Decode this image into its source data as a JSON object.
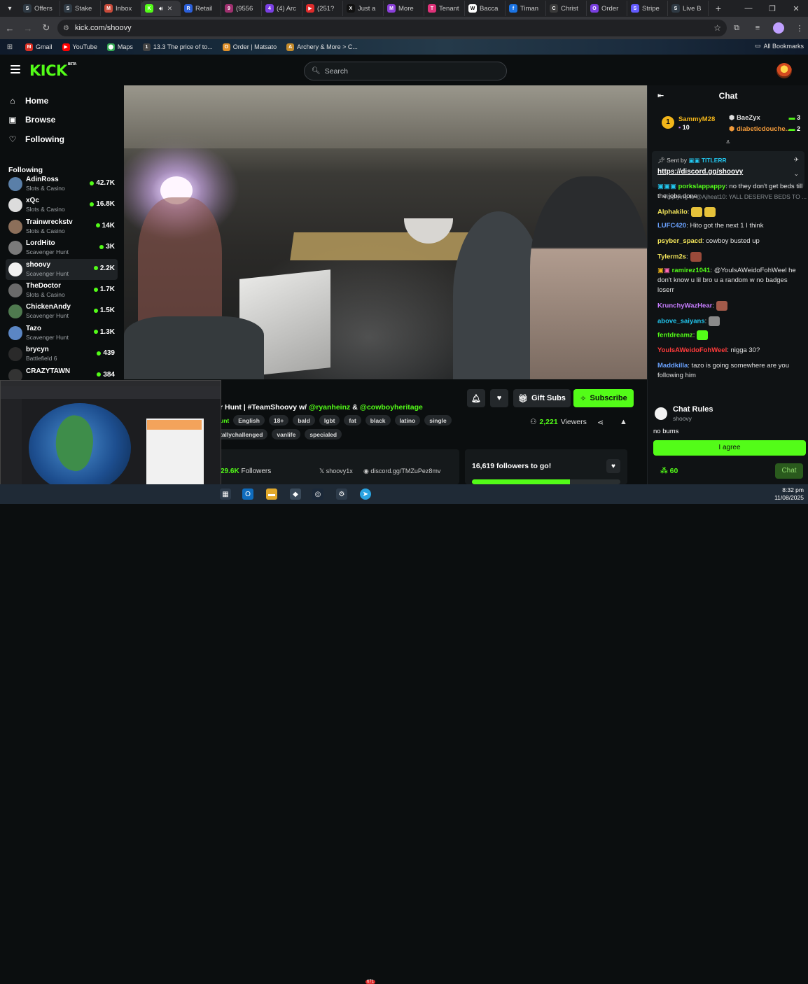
{
  "browser": {
    "tabs": [
      {
        "label": "Offers",
        "color": "#2f3a44",
        "glyph": "S"
      },
      {
        "label": "Stake",
        "color": "#2f3a44",
        "glyph": "S"
      },
      {
        "label": "Inbox",
        "color": "#c94b3b",
        "glyph": "M"
      },
      {
        "label": "",
        "color": "#53fc18",
        "glyph": "K",
        "active": true
      },
      {
        "label": "Retail",
        "color": "#2b5fd9",
        "glyph": "R"
      },
      {
        "label": "(9556",
        "color": "#a0306f",
        "glyph": "9"
      },
      {
        "label": "(4) Arc",
        "color": "#7b3fe4",
        "glyph": "4"
      },
      {
        "label": "(251?",
        "color": "#e02b2b",
        "glyph": "▶"
      },
      {
        "label": "Just a",
        "color": "#111111",
        "glyph": "X"
      },
      {
        "label": "More",
        "color": "#8b3fd9",
        "glyph": "M"
      },
      {
        "label": "Tenant",
        "color": "#e0327a",
        "glyph": "T"
      },
      {
        "label": "Bacca",
        "color": "#ffffff",
        "glyph": "W"
      },
      {
        "label": "Timan",
        "color": "#1b74e4",
        "glyph": "f"
      },
      {
        "label": "Christ",
        "color": "#3a3a3a",
        "glyph": "C"
      },
      {
        "label": "Order",
        "color": "#7a3fe0",
        "glyph": "O"
      },
      {
        "label": "Stripe",
        "color": "#635bff",
        "glyph": "S"
      },
      {
        "label": "Live B",
        "color": "#2f3a44",
        "glyph": "S"
      }
    ],
    "url": "kick.com/shoovy",
    "bookmarks": [
      {
        "label": "Gmail",
        "color": "#d93025",
        "glyph": "M"
      },
      {
        "label": "YouTube",
        "color": "#ff0000",
        "glyph": "▶"
      },
      {
        "label": "Maps",
        "color": "#34a853",
        "glyph": "⬤"
      },
      {
        "label": "13.3 The price of to...",
        "color": "#444444",
        "glyph": "1"
      },
      {
        "label": "Order | Matsato",
        "color": "#e0912b",
        "glyph": "O"
      },
      {
        "label": "Archery & More > C...",
        "color": "#c28a2b",
        "glyph": "A"
      }
    ],
    "all_bookmarks": "All Bookmarks"
  },
  "header": {
    "logo": "KICK",
    "logo_badge": "BETA",
    "search_placeholder": "Search"
  },
  "sidebar": {
    "nav": [
      {
        "label": "Home",
        "icon": "home-icon"
      },
      {
        "label": "Browse",
        "icon": "browse-icon"
      },
      {
        "label": "Following",
        "icon": "heart-icon"
      }
    ],
    "following_label": "Following",
    "channels": [
      {
        "name": "AdinRoss",
        "category": "Slots & Casino",
        "viewers": "42.7K",
        "color": "#5a7fa8"
      },
      {
        "name": "xQc",
        "category": "Slots & Casino",
        "viewers": "16.8K",
        "color": "#dcdcdc"
      },
      {
        "name": "Trainwreckstv",
        "category": "Slots & Casino",
        "viewers": "14K",
        "color": "#8c6f5a"
      },
      {
        "name": "LordHito",
        "category": "Scavenger Hunt",
        "viewers": "3K",
        "color": "#7a7a7a"
      },
      {
        "name": "shoovy",
        "category": "Scavenger Hunt",
        "viewers": "2.2K",
        "color": "#f2f2f2",
        "active": true
      },
      {
        "name": "TheDoctor",
        "category": "Slots & Casino",
        "viewers": "1.7K",
        "color": "#6a6a6a"
      },
      {
        "name": "ChickenAndy",
        "category": "Scavenger Hunt",
        "viewers": "1.5K",
        "color": "#4f7a4f"
      },
      {
        "name": "Tazo",
        "category": "Scavenger Hunt",
        "viewers": "1.3K",
        "color": "#5b86c4"
      },
      {
        "name": "brycyn",
        "category": "Battlefield 6",
        "viewers": "439",
        "color": "#2a2a2a"
      },
      {
        "name": "CRAZYTAWN",
        "category": "",
        "viewers": "384",
        "color": "#333333"
      }
    ]
  },
  "stream": {
    "title_prefix": "r Hunt | #TeamShoovy w/ ",
    "mention1": "@ryanheinz",
    "amp": " & ",
    "mention2": "@cowboyheritage",
    "category_partial": "unt",
    "tags": [
      "English",
      "18+",
      "bald",
      "lgbt",
      "fat",
      "black",
      "latino",
      "single"
    ],
    "tags2": [
      "tallychallenged",
      "vanlife",
      "speciaIed"
    ],
    "gift_subs": "Gift Subs",
    "subscribe": "Subscribe",
    "viewers": "2,221",
    "viewers_label": "Viewers",
    "followers_count": "29.6K",
    "followers_label": "Followers",
    "social1": "shoovy1x",
    "social2": "discord.gg/TMZuPez8mv",
    "goal_text": "16,619 followers to go!",
    "goal_progress": 0.66
  },
  "chat": {
    "title": "Chat",
    "top_gifters": [
      {
        "rank": "1",
        "name": "SammyM28",
        "count": "10",
        "color": "#f2b51a"
      },
      {
        "name": "BaeZyx",
        "count": "3",
        "color": "#e0e0e0"
      },
      {
        "name": "diabeticdouche...",
        "count": "2",
        "color": "#f29a3a"
      }
    ],
    "pinned_sent_by": "Sent by",
    "pinned_user": "TITLERR",
    "pinned_link": "https://discord.gg/shoovy",
    "reply_note": "Replying to @Ajheat10: YALL DESERVE BEDS TO ...",
    "messages": [
      {
        "user": "porkslappappy",
        "color": "#53fc18",
        "text": ": no they don't get beds till the jobs done"
      },
      {
        "user": "Alphakilo",
        "color": "#f2e45a",
        "text": ":"
      },
      {
        "user": "LUFC420",
        "color": "#6aa2ff",
        "text": ": Hito got the next 1 I think"
      },
      {
        "user": "psyber_spacd",
        "color": "#f2e45a",
        "text": ": cowboy busted up"
      },
      {
        "user": "Tylerm2s",
        "color": "#f2e45a",
        "text": ":"
      },
      {
        "user": "ramirez1041",
        "color": "#53fc18",
        "text": ": @YouIsAWeidoFohWeel he don't know u lil bro u a random w no badges loserr"
      },
      {
        "user": "KrunchyWazHear",
        "color": "#c77dff",
        "text": ":"
      },
      {
        "user": "above_saiyans",
        "color": "#22c7ef",
        "text": ":"
      },
      {
        "user": "fentdreamz",
        "color": "#53fc18",
        "text": ":"
      },
      {
        "user": "YouIsAWeidoFohWeel",
        "color": "#ff3b3b",
        "text": ": nigga 30?"
      },
      {
        "user": "Maddkilla",
        "color": "#6aa2ff",
        "text": ": tazo is going somewhere are you following him"
      }
    ],
    "rules_title": "Chat Rules",
    "rules_channel": "shoovy",
    "rules_body": "no bums",
    "agree": "I agree",
    "points": "60",
    "send": "Chat"
  },
  "taskbar": {
    "time": "8:32 pm",
    "date": "11/08/2025",
    "badge": "671"
  }
}
